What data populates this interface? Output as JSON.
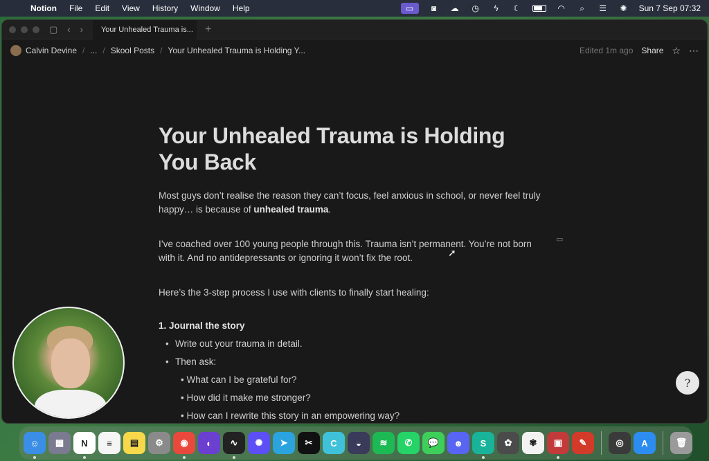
{
  "menubar": {
    "app_name": "Notion",
    "menus": [
      "File",
      "Edit",
      "View",
      "History",
      "Window",
      "Help"
    ],
    "datetime": "Sun 7 Sep  07:32",
    "icons": [
      "screen-share-icon",
      "app-icon",
      "cloud-icon",
      "timer-icon",
      "shortcut-icon",
      "moon-icon",
      "battery-icon",
      "wifi-icon",
      "search-icon",
      "control-center-icon",
      "siri-icon"
    ]
  },
  "window": {
    "tab_title": "Unhealed Trauma is...",
    "tab_title_full": "Your Unhealed Trauma is...",
    "breadcrumb": {
      "user": "Calvin Devine",
      "ellipsis": "...",
      "parent": "Skool Posts",
      "current": "Your Unhealed Trauma is Holding Y..."
    },
    "edited": "Edited 1m ago",
    "share": "Share"
  },
  "page": {
    "title": "Your Unhealed Trauma is Holding You Back",
    "para1_prefix": "Most guys don’t realise the reason they can’t focus, feel anxious in school, or never feel truly happy… is because of ",
    "para1_bold": "unhealed trauma",
    "para1_suffix": ".",
    "para2": "I’ve coached over 100 young people through this. Trauma isn’t permanent. You’re not born with it. And no  antidepressants or ignoring it won’t fix the root.",
    "para3": "Here’s the 3-step process I use with clients to finally start healing:",
    "step1": "1. Journal the story",
    "bullets": [
      "Write out your trauma in detail.",
      "Then ask:"
    ],
    "sub_bullets": [
      "• What can I be grateful for?",
      "• How did it make me stronger?",
      "• How can I rewrite this story in an empowering way?"
    ],
    "help_glyph": "?"
  },
  "dock": {
    "apps": [
      {
        "name": "finder",
        "color": "#3a8ee6",
        "glyph": "☺",
        "running": true
      },
      {
        "name": "launchpad",
        "color": "#7a7a90",
        "glyph": "▦",
        "running": false
      },
      {
        "name": "notion",
        "color": "#ffffff",
        "glyph": "N",
        "running": true
      },
      {
        "name": "reminders",
        "color": "#f5f5f5",
        "glyph": "≡",
        "running": false
      },
      {
        "name": "notes",
        "color": "#f7d84a",
        "glyph": "▤",
        "running": false
      },
      {
        "name": "system-settings",
        "color": "#8a8a8a",
        "glyph": "⚙",
        "running": false
      },
      {
        "name": "chrome",
        "color": "#e8493c",
        "glyph": "◉",
        "running": true
      },
      {
        "name": "arc",
        "color": "#6b3fd0",
        "glyph": "◐",
        "running": false
      },
      {
        "name": "audio-app",
        "color": "#222222",
        "glyph": "∿",
        "running": true
      },
      {
        "name": "perplexity",
        "color": "#5b4ff5",
        "glyph": "✺",
        "running": false
      },
      {
        "name": "telegram",
        "color": "#2aa3df",
        "glyph": "➤",
        "running": false
      },
      {
        "name": "capcut",
        "color": "#111111",
        "glyph": "✂",
        "running": false
      },
      {
        "name": "canva",
        "color": "#3fc2d9",
        "glyph": "C",
        "running": false
      },
      {
        "name": "vpn-app",
        "color": "#3a3a5a",
        "glyph": "◒",
        "running": false
      },
      {
        "name": "spotify",
        "color": "#1db954",
        "glyph": "≋",
        "running": false
      },
      {
        "name": "whatsapp",
        "color": "#25d366",
        "glyph": "✆",
        "running": false
      },
      {
        "name": "messages",
        "color": "#3ecf5a",
        "glyph": "💬",
        "running": false
      },
      {
        "name": "discord",
        "color": "#5865f2",
        "glyph": "☻",
        "running": false
      },
      {
        "name": "surfshark",
        "color": "#19b39a",
        "glyph": "S",
        "running": true
      },
      {
        "name": "vpn-shield",
        "color": "#4b4b4b",
        "glyph": "✿",
        "running": false
      },
      {
        "name": "photos",
        "color": "#f2f2f2",
        "glyph": "✾",
        "running": false
      },
      {
        "name": "game-app",
        "color": "#c23a3a",
        "glyph": "▣",
        "running": true
      },
      {
        "name": "brush-app",
        "color": "#d23a2a",
        "glyph": "✎",
        "running": false
      },
      {
        "name": "quicktime",
        "color": "#3a3a3a",
        "glyph": "◎",
        "running": false
      },
      {
        "name": "app-store",
        "color": "#2d8cf0",
        "glyph": "A",
        "running": false
      },
      {
        "name": "trash",
        "color": "#9a9a9a",
        "glyph": "🗑",
        "running": false
      }
    ]
  }
}
